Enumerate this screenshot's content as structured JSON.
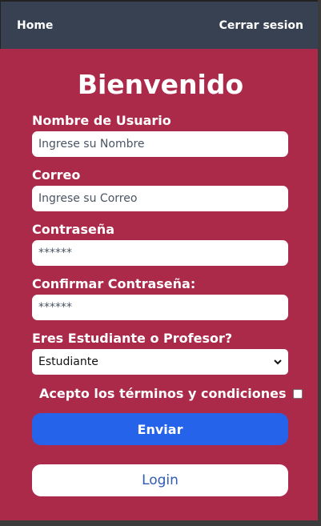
{
  "nav": {
    "home_label": "Home",
    "logout_label": "Cerrar sesion"
  },
  "form": {
    "title": "Bienvenido",
    "username": {
      "label": "Nombre de Usuario",
      "placeholder": "Ingrese su Nombre",
      "value": ""
    },
    "email": {
      "label": "Correo",
      "placeholder": "Ingrese su Correo",
      "value": ""
    },
    "password": {
      "label": "Contraseña",
      "placeholder": "******",
      "value": ""
    },
    "confirm_password": {
      "label": "Confirmar Contraseña:",
      "placeholder": "******",
      "value": ""
    },
    "role": {
      "label": "Eres Estudiante o Profesor?",
      "selected": "Estudiante"
    },
    "terms_label": "Acepto los términos y condiciones",
    "submit_label": "Enviar",
    "login_label": "Login"
  },
  "colors": {
    "nav_bg": "#374151",
    "panel_bg": "#ab2a4a",
    "primary": "#2563eb",
    "login_text": "#2f5bb5"
  },
  "icons": [
    "chevron-down-icon"
  ]
}
